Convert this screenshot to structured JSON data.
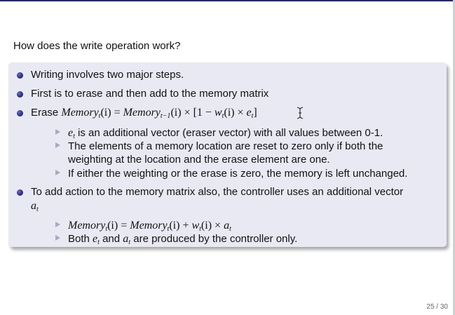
{
  "slide": {
    "title": "How does the write operation work?",
    "bullets": {
      "b1": "Writing involves two major steps.",
      "b2": "First is to erase and then add to the memory matrix",
      "b3_prefix": "Erase ",
      "b3_mem1": "Memory",
      "b3_sub1": "t",
      "b3_paren1": "(i)",
      "b3_eq": " = ",
      "b3_mem2": "Memory",
      "b3_sub2": "t−1",
      "b3_paren2": "(i)",
      "b3_times1": " × [1 − ",
      "b3_w": "w",
      "b3_sub3": "t",
      "b3_paren3": "(i)",
      "b3_times2": " × ",
      "b3_e": "e",
      "b3_sub4": "t",
      "b3_close": "]",
      "b4_line1": "To add action to the memory matrix also, the controller uses an additional vector",
      "b4_a": "a",
      "b4_sub": "t"
    },
    "sub_erase": {
      "s1_e": "e",
      "s1_sub": "t",
      "s1_text": " is an additional vector (eraser vector) with all values between 0-1.",
      "s2_line1": "The elements of a memory location are reset to zero only if both the",
      "s2_line2": "weighting at the location and the erase element are one.",
      "s3": "If either the weighting or the erase is zero, the memory is left unchanged."
    },
    "sub_add": {
      "s4_mem1": "Memory",
      "s4_sub1": "t",
      "s4_paren1": "(i)",
      "s4_eq": " = ",
      "s4_mem2": "Memory",
      "s4_sub2": "t",
      "s4_paren2": "(i)",
      "s4_plus": " + ",
      "s4_w": "w",
      "s4_sub3": "t",
      "s4_paren3": "(i)",
      "s4_times": " × ",
      "s4_a": "a",
      "s4_sub4": "t",
      "s5_pre": "Both ",
      "s5_e": "e",
      "s5_sub1": "t",
      "s5_and": " and ",
      "s5_a": "a",
      "s5_sub2": "t",
      "s5_post": " are produced by the controller only."
    },
    "page_number": "25 / 30",
    "icons": {
      "cursor": "text-cursor-icon"
    },
    "colors": {
      "block_bg": "#e9e9f4",
      "bullet": "#2d2d8e",
      "arrow": "#a9a9c7",
      "rule": "#2a2a6a"
    }
  }
}
